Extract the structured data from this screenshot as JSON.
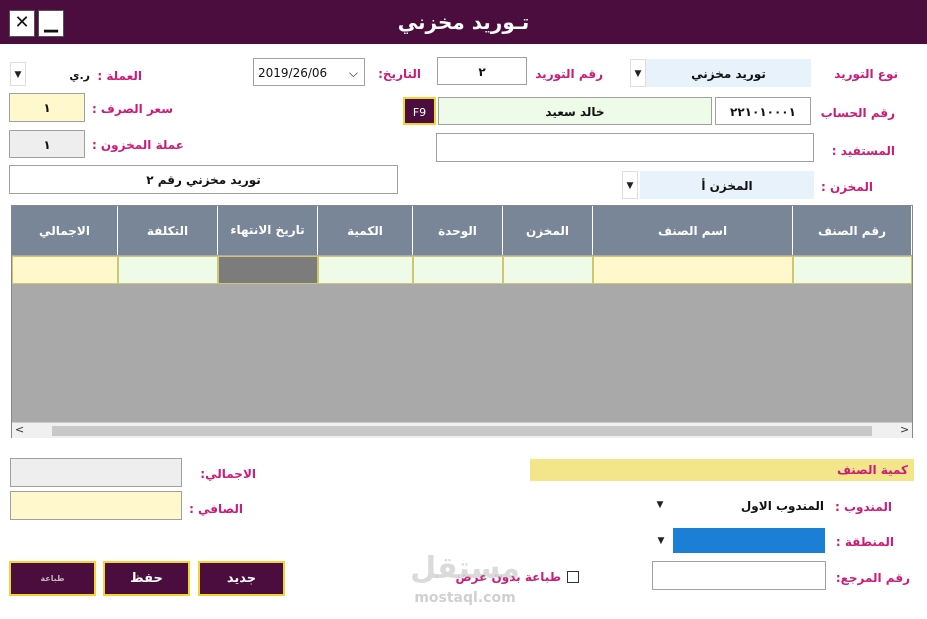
{
  "window": {
    "title": "تـوريد مخزني",
    "close_glyph": "✕",
    "minimize_glyph": "▁"
  },
  "header": {
    "supply_type_label": "نوع التوريد",
    "supply_type_value": "توريد مخزني",
    "supply_no_label": "رقم التوريد",
    "supply_no_value": "٢",
    "date_label": "التاريخ:",
    "date_value": "2019/26/06",
    "currency_label": "العملة :",
    "currency_value": "ر.ي",
    "account_label": "رقم الحساب",
    "account_no_value": "٢٢١٠١٠٠٠١",
    "account_name_value": "خالد سعيد",
    "f9_label": "F9",
    "exchange_label": "سعر الصرف :",
    "exchange_value": "١",
    "beneficiary_label": "المستفيد :",
    "beneficiary_value": "",
    "store_currency_label": "عملة المخزون :",
    "store_currency_value": "١",
    "store_label": "المخزن :",
    "store_value": "المخزن أ",
    "note_value": "توريد مخزني رقم ٢"
  },
  "grid": {
    "columns": [
      "رقم الصنف",
      "اسم الصنف",
      "المخزن",
      "الوحدة",
      "الكمية",
      "تاريخ الانتهاء",
      "التكلفة",
      "الاجمالي"
    ]
  },
  "totals": {
    "total_label": "الاجمالي:",
    "total_value": "",
    "net_label": "الصافي :",
    "net_value": ""
  },
  "side": {
    "item_qty_label": "كمية الصنف",
    "rep_label": "المندوب :",
    "rep_value": "المندوب الاول",
    "region_label": "المنطقة :",
    "ref_label": "رقم المرجع:",
    "ref_value": "",
    "print_no_preview_label": "طباعة بدون عرض"
  },
  "buttons": {
    "new": "جديد",
    "save": "حفظ",
    "print": "طباعة"
  },
  "watermark": {
    "logo_text": "مستقل",
    "site": "mostaql.com"
  },
  "colors": {
    "titlebar": "#4a0d3e",
    "label": "#cc1b78",
    "grid_header": "#798697",
    "button_border": "#f4d435",
    "region_fill": "#1b7fd6"
  }
}
